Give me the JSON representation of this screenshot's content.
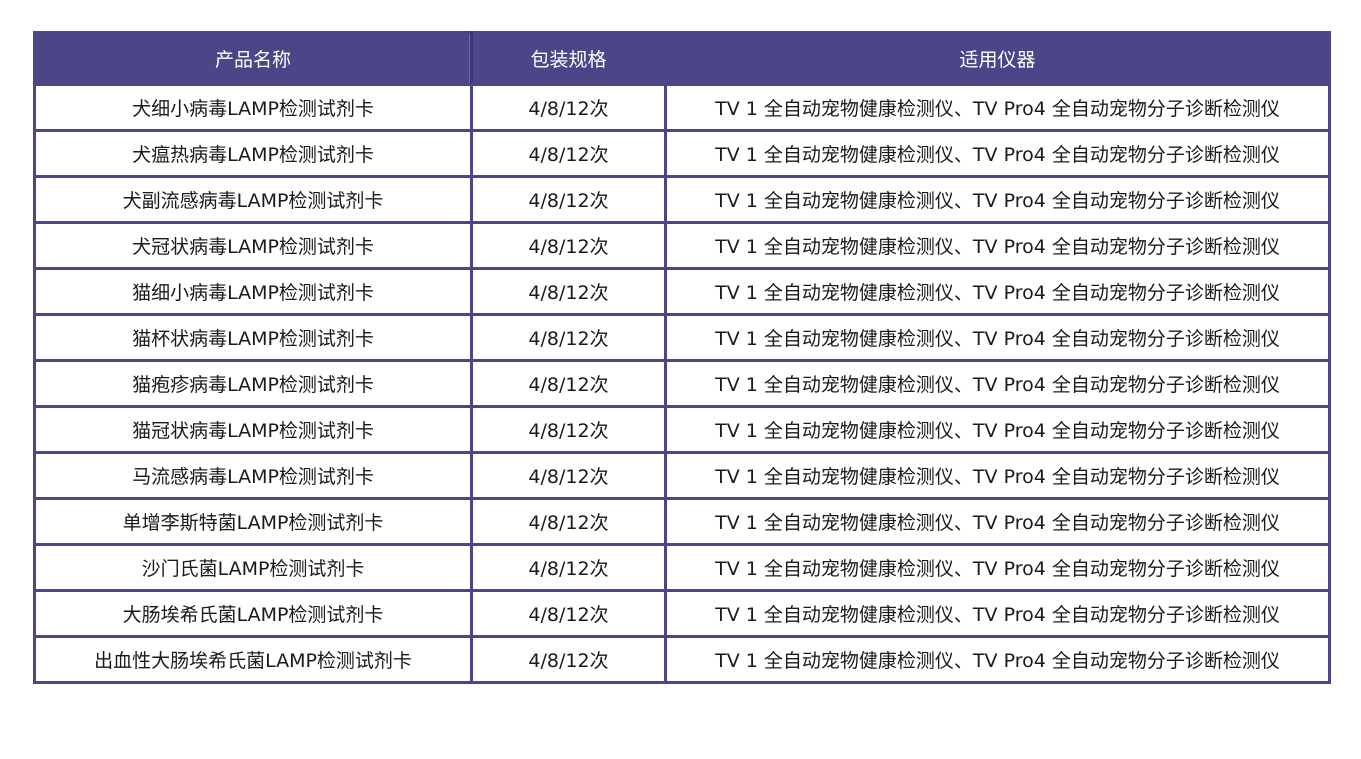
{
  "table": {
    "headers": [
      "产品名称",
      "包装规格",
      "适用仪器"
    ],
    "rows": [
      [
        "犬细小病毒LAMP检测试剂卡",
        "4/8/12次",
        "TV 1 全自动宠物健康检测仪、TV Pro4 全自动宠物分子诊断检测仪"
      ],
      [
        "犬瘟热病毒LAMP检测试剂卡",
        "4/8/12次",
        "TV 1 全自动宠物健康检测仪、TV Pro4 全自动宠物分子诊断检测仪"
      ],
      [
        "犬副流感病毒LAMP检测试剂卡",
        "4/8/12次",
        "TV 1 全自动宠物健康检测仪、TV Pro4 全自动宠物分子诊断检测仪"
      ],
      [
        "犬冠状病毒LAMP检测试剂卡",
        "4/8/12次",
        "TV 1 全自动宠物健康检测仪、TV Pro4 全自动宠物分子诊断检测仪"
      ],
      [
        "猫细小病毒LAMP检测试剂卡",
        "4/8/12次",
        "TV 1 全自动宠物健康检测仪、TV Pro4 全自动宠物分子诊断检测仪"
      ],
      [
        "猫杯状病毒LAMP检测试剂卡",
        "4/8/12次",
        "TV 1 全自动宠物健康检测仪、TV Pro4 全自动宠物分子诊断检测仪"
      ],
      [
        "猫疱疹病毒LAMP检测试剂卡",
        "4/8/12次",
        "TV 1 全自动宠物健康检测仪、TV Pro4 全自动宠物分子诊断检测仪"
      ],
      [
        "猫冠状病毒LAMP检测试剂卡",
        "4/8/12次",
        "TV 1 全自动宠物健康检测仪、TV Pro4 全自动宠物分子诊断检测仪"
      ],
      [
        "马流感病毒LAMP检测试剂卡",
        "4/8/12次",
        "TV 1 全自动宠物健康检测仪、TV Pro4 全自动宠物分子诊断检测仪"
      ],
      [
        "单增李斯特菌LAMP检测试剂卡",
        "4/8/12次",
        "TV 1 全自动宠物健康检测仪、TV Pro4 全自动宠物分子诊断检测仪"
      ],
      [
        "沙门氏菌LAMP检测试剂卡",
        "4/8/12次",
        "TV 1 全自动宠物健康检测仪、TV Pro4 全自动宠物分子诊断检测仪"
      ],
      [
        "大肠埃希氏菌LAMP检测试剂卡",
        "4/8/12次",
        "TV 1 全自动宠物健康检测仪、TV Pro4 全自动宠物分子诊断检测仪"
      ],
      [
        "出血性大肠埃希氏菌LAMP检测试剂卡",
        "4/8/12次",
        "TV 1 全自动宠物健康检测仪、TV Pro4 全自动宠物分子诊断检测仪"
      ]
    ]
  },
  "colors": {
    "header_bg": "#4a4688",
    "border": "#4a4688",
    "header_text": "#ffffff",
    "body_text": "#1a1a1a"
  }
}
